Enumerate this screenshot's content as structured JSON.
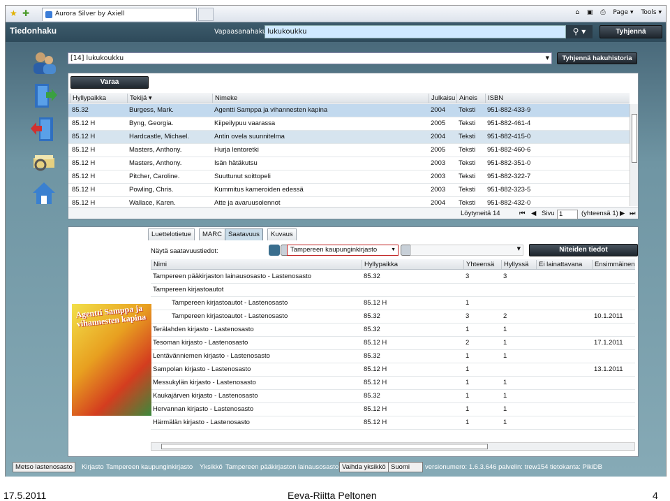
{
  "browser": {
    "tab_title": "Aurora Silver by Axiell",
    "tools": [
      "Page ▾",
      "Tools ▾"
    ]
  },
  "app": {
    "title": "Tiedonhaku",
    "keyword_label": "Vapaasanahaku",
    "keyword_value": "lukukoukku",
    "clear_label": "Tyhjennä",
    "history_value": "[14] lukukoukku",
    "clear_history_label": "Tyhjennä hakuhistoria"
  },
  "results": {
    "reserve_label": "Varaa",
    "headers": [
      "Hyllypaikka",
      "Tekijä ▾",
      "Nimeke",
      "Julkaisu",
      "Aineis",
      "ISBN"
    ],
    "rows": [
      [
        "85.32",
        "Burgess, Mark.",
        "Agentti Samppa ja vihannesten kapina",
        "2004",
        "Teksti",
        "951-882-433-9"
      ],
      [
        "85.12 H",
        "Byng, Georgia.",
        "Kiipeilypuu vaarassa",
        "2005",
        "Teksti",
        "951-882-461-4"
      ],
      [
        "85.12 H",
        "Hardcastle, Michael.",
        "Antin ovela suunnitelma",
        "2004",
        "Teksti",
        "951-882-415-0"
      ],
      [
        "85.12 H",
        "Masters, Anthony.",
        "Hurja lentoretki",
        "2005",
        "Teksti",
        "951-882-460-6"
      ],
      [
        "85.12 H",
        "Masters, Anthony.",
        "Isän hätäkutsu",
        "2003",
        "Teksti",
        "951-882-351-0"
      ],
      [
        "85.12 H",
        "Pitcher, Caroline.",
        "Suuttunut soittopeli",
        "2003",
        "Teksti",
        "951-882-322-7"
      ],
      [
        "85.12 H",
        "Powling, Chris.",
        "Kummitus kameroiden edessä",
        "2003",
        "Teksti",
        "951-882-323-5"
      ],
      [
        "85.12 H",
        "Wallace, Karen.",
        "Atte ja avaruusolennot",
        "2004",
        "Teksti",
        "951-882-432-0"
      ]
    ],
    "found_label": "Löytyneitä 14",
    "page_label": "Sivu",
    "page_value": "1",
    "page_total": "(yhteensä 1)"
  },
  "details": {
    "tabs": [
      "Luettelotietue",
      "MARC",
      "Saatavuus",
      "Kuvaus"
    ],
    "active_tab": "Saatavuus",
    "show_label": "Näytä saatavuustiedot:",
    "library_select": "Tampereen kaupunginkirjasto",
    "copies_button": "Niteiden tiedot",
    "headers": [
      "Nimi",
      "Hyllypaikka",
      "Yhteensä",
      "Hyllyssä",
      "Ei lainattavana",
      "Ensimmäinen"
    ],
    "rows": [
      [
        "Tampereen pääkirjaston lainausosasto - Lastenosasto",
        "85.32",
        "3",
        "3",
        "",
        ""
      ],
      [
        "Tampereen kirjastoautot",
        "",
        "",
        "",
        "",
        ""
      ],
      [
        "Tampereen kirjastoautot - Lastenosasto",
        "85.12 H",
        "1",
        "",
        "",
        ""
      ],
      [
        "Tampereen kirjastoautot - Lastenosasto",
        "85.32",
        "3",
        "2",
        "",
        "10.1.2011"
      ],
      [
        "Terälahden kirjasto - Lastenosasto",
        "85.32",
        "1",
        "1",
        "",
        ""
      ],
      [
        "Tesoman kirjasto - Lastenosasto",
        "85.12 H",
        "2",
        "1",
        "",
        "17.1.2011"
      ],
      [
        "Lentävänniemen kirjasto - Lastenosasto",
        "85.32",
        "1",
        "1",
        "",
        ""
      ],
      [
        "Sampolan kirjasto - Lastenosasto",
        "85.12 H",
        "1",
        "",
        "",
        "13.1.2011"
      ],
      [
        "Messukylän kirjasto - Lastenosasto",
        "85.12 H",
        "1",
        "1",
        "",
        ""
      ],
      [
        "Kaukajärven kirjasto - Lastenosasto",
        "85.32",
        "1",
        "1",
        "",
        ""
      ],
      [
        "Hervannan kirjasto - Lastenosasto",
        "85.12 H",
        "1",
        "1",
        "",
        ""
      ],
      [
        "Härmälän kirjasto - Lastenosasto",
        "85.12 H",
        "1",
        "1",
        "",
        ""
      ]
    ],
    "cover_text": "Agentti Samppa ja vihannesten kapina"
  },
  "status": {
    "unit_button": "Metso lastenosasto",
    "library_label": "Kirjasto",
    "library_value": "Tampereen kaupunginkirjasto",
    "unit_label": "Yksikkö",
    "unit_value": "Tampereen pääkirjaston lainausosasto",
    "change_unit": "Vaihda yksikkö",
    "language": "Suomi",
    "version_info": "versionumero: 1.6.3.646 palvelin: trew154 tietokanta: PikiDB"
  },
  "slide": {
    "date": "17.5.2011",
    "author": "Eeva-Riitta Peltonen",
    "page": "4"
  }
}
